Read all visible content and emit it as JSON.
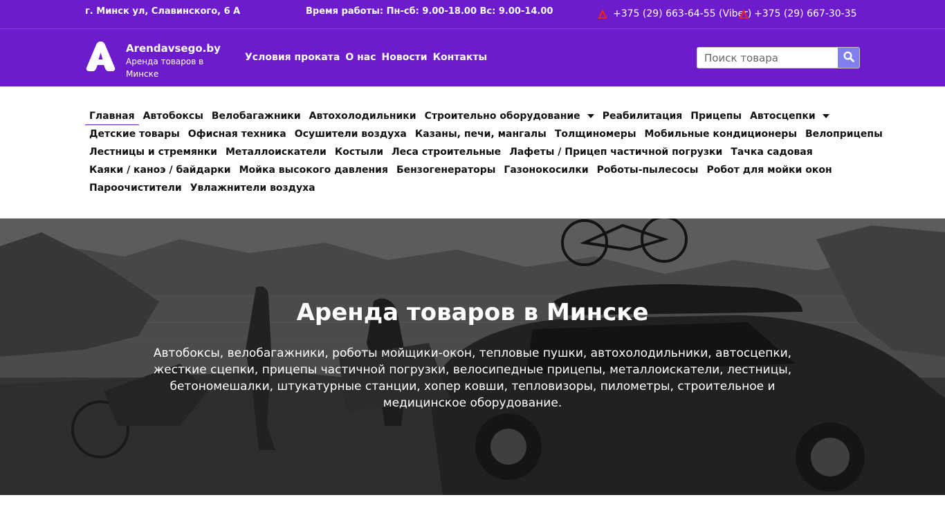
{
  "topbar": {
    "address": "г. Минск ул, Славинского, 6 А",
    "hours": "Время работы: Пн-сб: 9.00-18.00 Вс: 9.00-14.00",
    "phones": [
      {
        "number": "+375 (29) 663-64-55 (Viber)",
        "icon": "operator-icon"
      },
      {
        "number": "+375 (29) 667-30-35",
        "icon": "operator-icon"
      }
    ],
    "colors": {
      "bar": "#6c1ccd"
    }
  },
  "header": {
    "brand_name": "Arendavsego.by",
    "brand_sub": "Аренда товаров в Минске",
    "logo_icon": "logo-a-icon",
    "nav": [
      "Условия проката",
      "О нас",
      "Новости",
      "Контакты"
    ],
    "search": {
      "placeholder": "Поиск товара",
      "value": "",
      "button_icon": "search-icon"
    }
  },
  "categories": {
    "rows": [
      [
        {
          "label": "Главная",
          "active": true
        },
        {
          "label": "Автобоксы"
        },
        {
          "label": "Велобагажники"
        },
        {
          "label": "Автохолодильники"
        },
        {
          "label": "Строительно оборудование",
          "dropdown": true
        },
        {
          "label": "Реабилитация"
        },
        {
          "label": "Прицепы"
        },
        {
          "label": "Автосцепки",
          "dropdown": true
        }
      ],
      [
        {
          "label": "Детские товары"
        },
        {
          "label": "Офисная техника"
        },
        {
          "label": "Осушители воздуха"
        },
        {
          "label": "Казаны, печи, мангалы"
        },
        {
          "label": "Толщиномеры"
        },
        {
          "label": "Мобильные кондиционеры"
        },
        {
          "label": "Велоприцепы"
        }
      ],
      [
        {
          "label": "Лестницы и стремянки"
        },
        {
          "label": "Металлоискатели"
        },
        {
          "label": "Костыли"
        },
        {
          "label": "Леса строительные"
        },
        {
          "label": "Лафеты / Прицеп частичной погрузки"
        },
        {
          "label": "Тачка садовая"
        }
      ],
      [
        {
          "label": "Каяки / каноэ / байдарки"
        },
        {
          "label": "Мойка высокого давления"
        },
        {
          "label": "Бензогенераторы"
        },
        {
          "label": "Газонокосилки"
        },
        {
          "label": "Роботы-пылесосы"
        },
        {
          "label": "Робот для мойки окон"
        }
      ],
      [
        {
          "label": "Пароочистители"
        },
        {
          "label": "Увлажнители воздуха"
        }
      ]
    ]
  },
  "hero": {
    "title": "Аренда товаров в Минске",
    "text": "Автобоксы, велобагажники, роботы мойщики-окон, тепловые пушки, автохолодильники, автосцепки, жесткие сцепки, прицепы частичной погрузки, велосипедные прицепы, металлоискатели, лестницы, бетономешалки, штукатурные станции, хопер ковши, тепловизоры, пилометры, строительное и медицинское оборудование."
  }
}
